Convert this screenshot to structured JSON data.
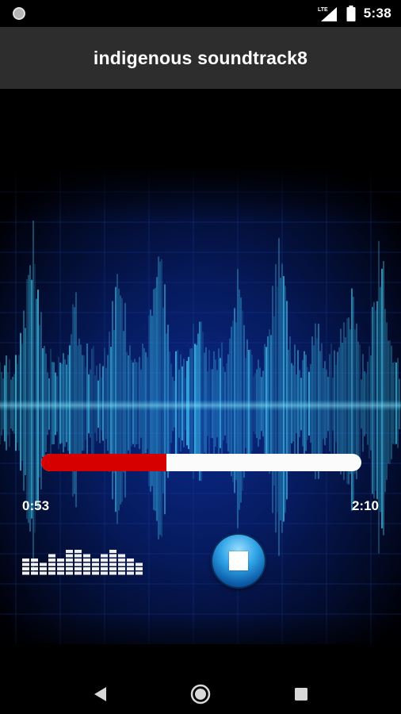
{
  "status_bar": {
    "time": "5:38",
    "network": "LTE"
  },
  "app_bar": {
    "title": "indigenous soundtrack8"
  },
  "player": {
    "elapsed": "0:53",
    "duration": "2:10",
    "progress_fraction": 0.39,
    "stop_icon": "stop-icon",
    "equalizer_icon": "equalizer-icon"
  },
  "nav_bar": {
    "back_icon": "back-triangle-icon",
    "home_icon": "home-circle-icon",
    "recents_icon": "recents-square-icon"
  },
  "colors": {
    "progress_played": "#d60000",
    "progress_track": "#fbfbfb",
    "wave": "#3fd6ff",
    "app_bar": "#2d2d2d"
  }
}
